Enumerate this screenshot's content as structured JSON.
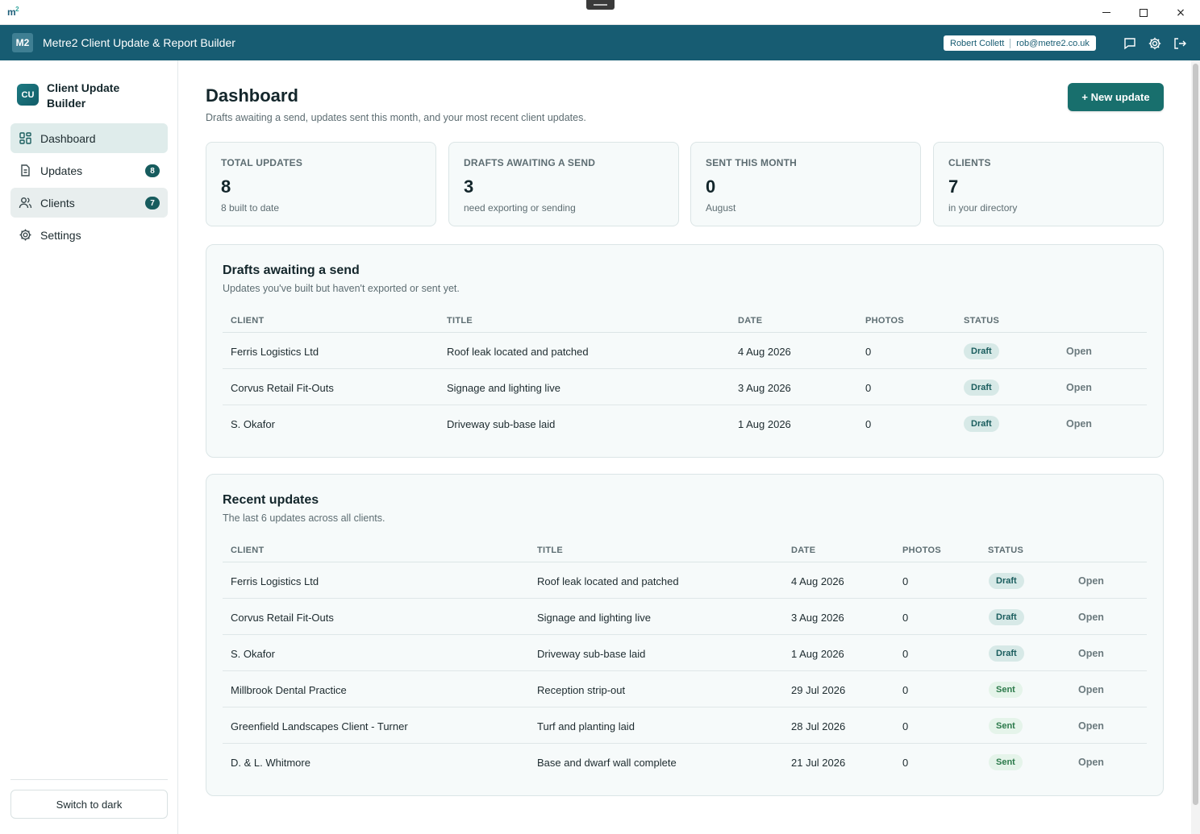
{
  "window": {
    "logo_text": "m",
    "logo_super": "2",
    "controls": {
      "minimize": "minimize",
      "maximize": "maximize",
      "close": "×"
    }
  },
  "appbar": {
    "mark": "M2",
    "title": "Metre2 Client Update & Report Builder",
    "user_name": "Robert Collett",
    "user_email": "rob@metre2.co.uk",
    "icons": [
      "chat-icon",
      "gear-icon",
      "logout-icon"
    ]
  },
  "sidebar": {
    "brand_badge": "CU",
    "brand_name": "Client Update Builder",
    "items": [
      {
        "label": "Dashboard",
        "icon": "dashboard-icon",
        "count": ""
      },
      {
        "label": "Updates",
        "icon": "document-icon",
        "count": "8"
      },
      {
        "label": "Clients",
        "icon": "users-icon",
        "count": "7"
      },
      {
        "label": "Settings",
        "icon": "gear-icon",
        "count": ""
      }
    ],
    "theme_toggle": "Switch to dark"
  },
  "header": {
    "title": "Dashboard",
    "subtitle": "Drafts awaiting a send, updates sent this month, and your most recent client updates.",
    "new_button": "+ New update"
  },
  "stats": [
    {
      "label": "TOTAL UPDATES",
      "value": "8",
      "caption": "8 built to date"
    },
    {
      "label": "DRAFTS AWAITING A SEND",
      "value": "3",
      "caption": "need exporting or sending"
    },
    {
      "label": "SENT THIS MONTH",
      "value": "0",
      "caption": "August"
    },
    {
      "label": "CLIENTS",
      "value": "7",
      "caption": "in your directory"
    }
  ],
  "drafts": {
    "title": "Drafts awaiting a send",
    "subtitle": "Updates you've built but haven't exported or sent yet.",
    "columns": [
      "CLIENT",
      "TITLE",
      "DATE",
      "PHOTOS",
      "STATUS"
    ],
    "rows": [
      {
        "client": "Ferris Logistics Ltd",
        "title": "Roof leak located and patched",
        "date": "4 Aug 2026",
        "photos": "0",
        "status": "Draft",
        "action": "Open"
      },
      {
        "client": "Corvus Retail Fit-Outs",
        "title": "Signage and lighting live",
        "date": "3 Aug 2026",
        "photos": "0",
        "status": "Draft",
        "action": "Open"
      },
      {
        "client": "S. Okafor",
        "title": "Driveway sub-base laid",
        "date": "1 Aug 2026",
        "photos": "0",
        "status": "Draft",
        "action": "Open"
      }
    ]
  },
  "recent": {
    "title": "Recent updates",
    "subtitle": "The last 6 updates across all clients.",
    "columns": [
      "CLIENT",
      "TITLE",
      "DATE",
      "PHOTOS",
      "STATUS"
    ],
    "rows": [
      {
        "client": "Ferris Logistics Ltd",
        "title": "Roof leak located and patched",
        "date": "4 Aug 2026",
        "photos": "0",
        "status": "Draft",
        "action": "Open"
      },
      {
        "client": "Corvus Retail Fit-Outs",
        "title": "Signage and lighting live",
        "date": "3 Aug 2026",
        "photos": "0",
        "status": "Draft",
        "action": "Open"
      },
      {
        "client": "S. Okafor",
        "title": "Driveway sub-base laid",
        "date": "1 Aug 2026",
        "photos": "0",
        "status": "Draft",
        "action": "Open"
      },
      {
        "client": "Millbrook Dental Practice",
        "title": "Reception strip-out",
        "date": "29 Jul 2026",
        "photos": "0",
        "status": "Sent",
        "action": "Open"
      },
      {
        "client": "Greenfield Landscapes Client - Turner",
        "title": "Turf and planting laid",
        "date": "28 Jul 2026",
        "photos": "0",
        "status": "Sent",
        "action": "Open"
      },
      {
        "client": "D. & L. Whitmore",
        "title": "Base and dwarf wall complete",
        "date": "21 Jul 2026",
        "photos": "0",
        "status": "Sent",
        "action": "Open"
      }
    ]
  },
  "colors": {
    "appbar": "#175c72",
    "accent": "#186f6d",
    "draft_pill": "#d7e9e7",
    "sent_pill": "#e5f4ea"
  }
}
